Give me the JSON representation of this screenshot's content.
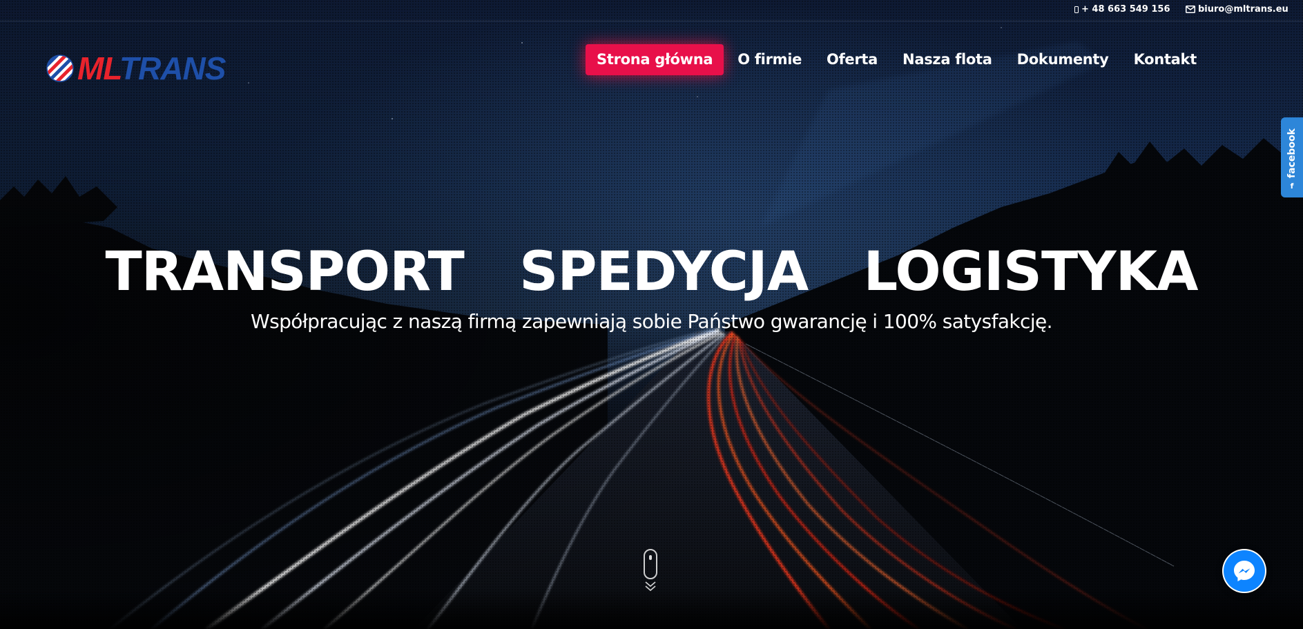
{
  "topbar": {
    "phone": "+ 48 663 549 156",
    "email": "biuro@mltrans.eu"
  },
  "logo": {
    "brand_part1": "ML",
    "brand_part2": "TRANS",
    "colors": {
      "red": "#e8232c",
      "blue": "#1e4fa8"
    }
  },
  "nav": {
    "items": [
      {
        "label": "Strona główna",
        "active": true
      },
      {
        "label": "O firmie"
      },
      {
        "label": "Oferta"
      },
      {
        "label": "Nasza flota"
      },
      {
        "label": "Dokumenty"
      },
      {
        "label": "Kontakt"
      }
    ],
    "active_color": "#e8104a"
  },
  "hero": {
    "headline": "TRANSPORT  SPEDYCJA  LOGISTYKA",
    "subline": "Współpracując z naszą firmą zapewniają sobie Państwo gwarancję i 100% satysfakcję."
  },
  "scroll_indicator": {
    "icon": "mouse-scroll-icon"
  },
  "facebook_tab": {
    "label": "facebook",
    "icon_glyph": "f",
    "color": "#2d86d9"
  },
  "messenger": {
    "icon": "messenger-icon",
    "color": "#0d84ff"
  }
}
